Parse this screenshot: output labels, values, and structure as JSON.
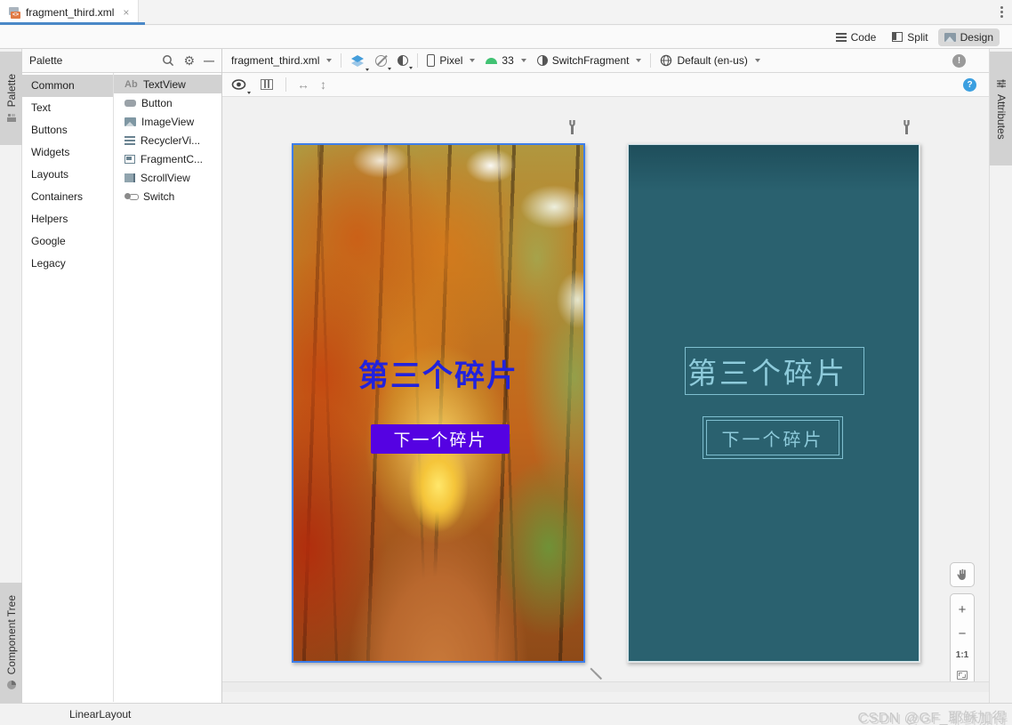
{
  "window": {
    "tab_title": "fragment_third.xml",
    "tab_close": "×",
    "kebab_menu": "⋮"
  },
  "mode_switcher": {
    "code": "Code",
    "split": "Split",
    "design": "Design",
    "selected": "Design"
  },
  "side_tabs": {
    "palette": "Palette",
    "component_tree": "Component Tree",
    "attributes": "Attributes"
  },
  "palette": {
    "title": "Palette",
    "selected_category": "Common",
    "categories": [
      "Common",
      "Text",
      "Buttons",
      "Widgets",
      "Layouts",
      "Containers",
      "Helpers",
      "Google",
      "Legacy"
    ],
    "selected_component": "TextView",
    "components": [
      {
        "name": "TextView",
        "icon_label": "Ab"
      },
      {
        "name": "Button"
      },
      {
        "name": "ImageView"
      },
      {
        "name": "RecyclerVi..."
      },
      {
        "name": "FragmentC..."
      },
      {
        "name": "ScrollView"
      },
      {
        "name": "Switch"
      }
    ]
  },
  "design_toolbar": {
    "file_selector": "fragment_third.xml",
    "device": "Pixel",
    "api_level": "33",
    "theme": "SwitchFragment",
    "locale": "Default (en-us)",
    "warning_badge": "!",
    "help_badge": "?"
  },
  "surface_toolbar": {
    "h_arrow": "↔",
    "v_arrow": "↕"
  },
  "preview": {
    "design": {
      "title_text": "第三个碎片",
      "button_text": "下一个碎片",
      "title_color": "#2222dd",
      "button_color": "#5502e2"
    },
    "blueprint": {
      "title_text": "第三个碎片",
      "button_text": "下一个碎片",
      "background_color": "#2a616f",
      "line_color": "#8ecbdb"
    }
  },
  "zoom_controls": {
    "zoom_in": "+",
    "zoom_out": "−",
    "ratio": "1:1"
  },
  "status_bar": {
    "breadcrumb": "LinearLayout",
    "watermark": "CSDN @GF_耶稣加得"
  }
}
